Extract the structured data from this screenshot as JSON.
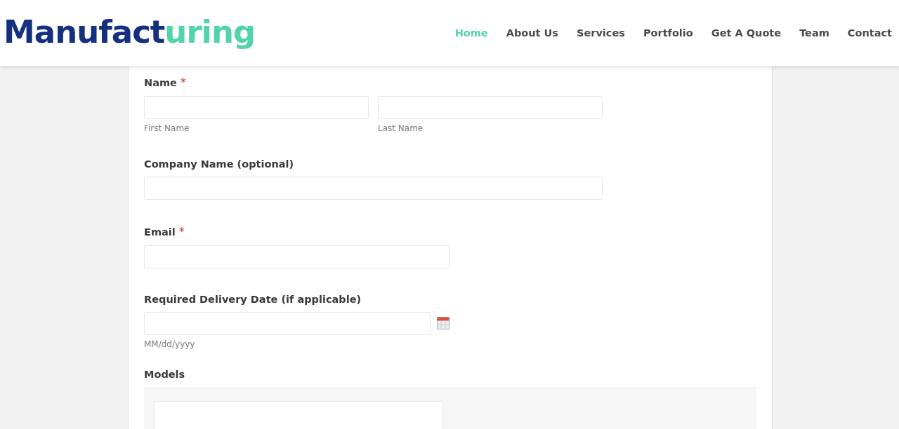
{
  "logo": {
    "first": "Manufact",
    "second": "uring"
  },
  "nav": [
    {
      "label": "Home",
      "selected": true
    },
    {
      "label": "About Us",
      "selected": false
    },
    {
      "label": "Services",
      "selected": false
    },
    {
      "label": "Portfolio",
      "selected": false
    },
    {
      "label": "Get A Quote",
      "selected": false
    },
    {
      "label": "Team",
      "selected": false
    },
    {
      "label": "Contact",
      "selected": false
    }
  ],
  "form": {
    "fields": [
      {
        "kind": "name",
        "label": "Name",
        "required_mark": "*",
        "subfields": [
          {
            "hint": "First Name"
          },
          {
            "hint": "Last Name"
          }
        ]
      },
      {
        "kind": "text",
        "label": "Company Name (optional)"
      },
      {
        "kind": "email",
        "label": "Email",
        "required_mark": "*"
      },
      {
        "kind": "date",
        "label": "Required Delivery Date (if applicable)",
        "hint": "MM/dd/yyyy"
      },
      {
        "kind": "models",
        "label": "Models"
      }
    ]
  }
}
